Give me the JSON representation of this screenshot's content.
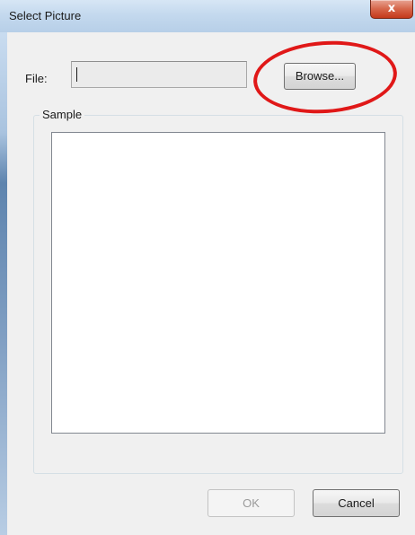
{
  "window": {
    "title": "Select Picture",
    "close_glyph": "x",
    "close_icon": "close-icon"
  },
  "file": {
    "label": "File:",
    "value": "",
    "browse_label": "Browse..."
  },
  "sample": {
    "label": "Sample"
  },
  "buttons": {
    "ok_label": "OK",
    "ok_enabled": false,
    "cancel_label": "Cancel"
  },
  "annotation": {
    "shape": "ellipse",
    "target": "browse-button",
    "color": "#e01818"
  },
  "colors": {
    "titlebar": "#c4d9ee",
    "close_button": "#d6664a",
    "dialog_background": "#f0f0f0"
  }
}
